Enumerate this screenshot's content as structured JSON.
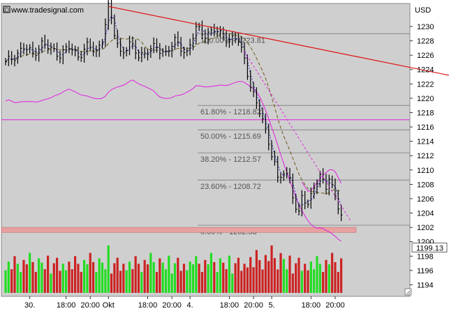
{
  "watermark": "© www.tradesignal.com",
  "currency": "USD",
  "last_price": "1199.13",
  "colors": {
    "plot_bg": "#cfcfcf",
    "frame_bg": "#ffffff",
    "price": "#000000",
    "ma_fast": "#3030c0",
    "ma_slow": "#6e5a14",
    "envelope": "#e020e0",
    "trendline": "#e01010",
    "support_band": "#e8a0a0",
    "vol_up": "#22dd22",
    "vol_down": "#cc2222",
    "fib_line": "#7a7a7a"
  },
  "x_labels": [
    {
      "text": "30.",
      "idx": 8
    },
    {
      "text": "18:00",
      "idx": 20
    },
    {
      "text": "20:00",
      "idx": 28
    },
    {
      "text": "Okt",
      "idx": 34
    },
    {
      "text": "18:00",
      "idx": 47
    },
    {
      "text": "20:00",
      "idx": 55
    },
    {
      "text": "4.",
      "idx": 61
    },
    {
      "text": "18:00",
      "idx": 74
    },
    {
      "text": "20:00",
      "idx": 82
    },
    {
      "text": "5.",
      "idx": 88
    },
    {
      "text": "18:00",
      "idx": 101
    },
    {
      "text": "20:00",
      "idx": 109
    }
  ],
  "fib_levels": [
    {
      "label": "100.00% - 1223.81",
      "price": 1229.0
    },
    {
      "label": "61.80% - 1218.82",
      "price": 1219.0
    },
    {
      "label": "50.00% - 1215.69",
      "price": 1215.6
    },
    {
      "label": "38.20% - 1212.57",
      "price": 1212.4
    },
    {
      "label": "23.60% - 1208.72",
      "price": 1208.6
    },
    {
      "label": "0.00% - 1202.53",
      "price": 1202.3
    }
  ],
  "chart_data": {
    "type": "line",
    "ylabel": "USD",
    "ylim": [
      1192.5,
      1233.5
    ],
    "y_ticks": [
      1194,
      1196,
      1198,
      1200,
      1202,
      1204,
      1206,
      1208,
      1210,
      1212,
      1214,
      1216,
      1218,
      1220,
      1222,
      1224,
      1226,
      1228,
      1230
    ],
    "n_bars": 112,
    "price_keypoints": [
      [
        0,
        1224.8
      ],
      [
        3,
        1226.0
      ],
      [
        6,
        1227.0
      ],
      [
        9,
        1226.2
      ],
      [
        12,
        1227.6
      ],
      [
        15,
        1226.8
      ],
      [
        18,
        1226.2
      ],
      [
        21,
        1227.0
      ],
      [
        24,
        1226.0
      ],
      [
        27,
        1227.2
      ],
      [
        30,
        1226.4
      ],
      [
        32,
        1228.4
      ],
      [
        34,
        1232.6
      ],
      [
        36,
        1229.0
      ],
      [
        38,
        1226.4
      ],
      [
        41,
        1227.4
      ],
      [
        44,
        1226.0
      ],
      [
        47,
        1226.6
      ],
      [
        50,
        1227.0
      ],
      [
        53,
        1226.4
      ],
      [
        56,
        1227.8
      ],
      [
        60,
        1226.4
      ],
      [
        63,
        1229.6
      ],
      [
        66,
        1229.0
      ],
      [
        69,
        1229.4
      ],
      [
        72,
        1228.6
      ],
      [
        74,
        1228.4
      ],
      [
        77,
        1228.0
      ],
      [
        79,
        1225.4
      ],
      [
        81,
        1222.0
      ],
      [
        83,
        1219.0
      ],
      [
        85,
        1217.0
      ],
      [
        87,
        1214.0
      ],
      [
        89,
        1211.0
      ],
      [
        90,
        1208.4
      ],
      [
        92,
        1209.6
      ],
      [
        94,
        1209.0
      ],
      [
        96,
        1204.6
      ],
      [
        97,
        1203.6
      ],
      [
        98,
        1206.2
      ],
      [
        100,
        1205.2
      ],
      [
        102,
        1208.0
      ],
      [
        104,
        1208.8
      ],
      [
        106,
        1207.6
      ],
      [
        107,
        1209.0
      ],
      [
        109,
        1206.6
      ],
      [
        111,
        1203.4
      ],
      [
        112,
        1200.4
      ],
      [
        113,
        1199.3
      ]
    ],
    "volume_pattern": [
      0.35,
      0.55,
      0.25,
      0.75,
      0.45,
      0.3,
      0.6,
      0.4,
      0.85,
      0.5,
      0.3,
      0.65,
      0.45,
      0.35,
      0.7,
      0.25,
      0.5,
      0.6,
      0.3,
      0.45
    ],
    "trendline": [
      [
        34,
        1232.8
      ],
      [
        112,
        1223.2
      ]
    ],
    "horizontal_line": 1217.0,
    "support_band": [
      1201.3,
      1202.0
    ],
    "dashed_channel": [
      [
        79,
        1226.5
      ],
      [
        114,
        1203.0
      ]
    ]
  }
}
